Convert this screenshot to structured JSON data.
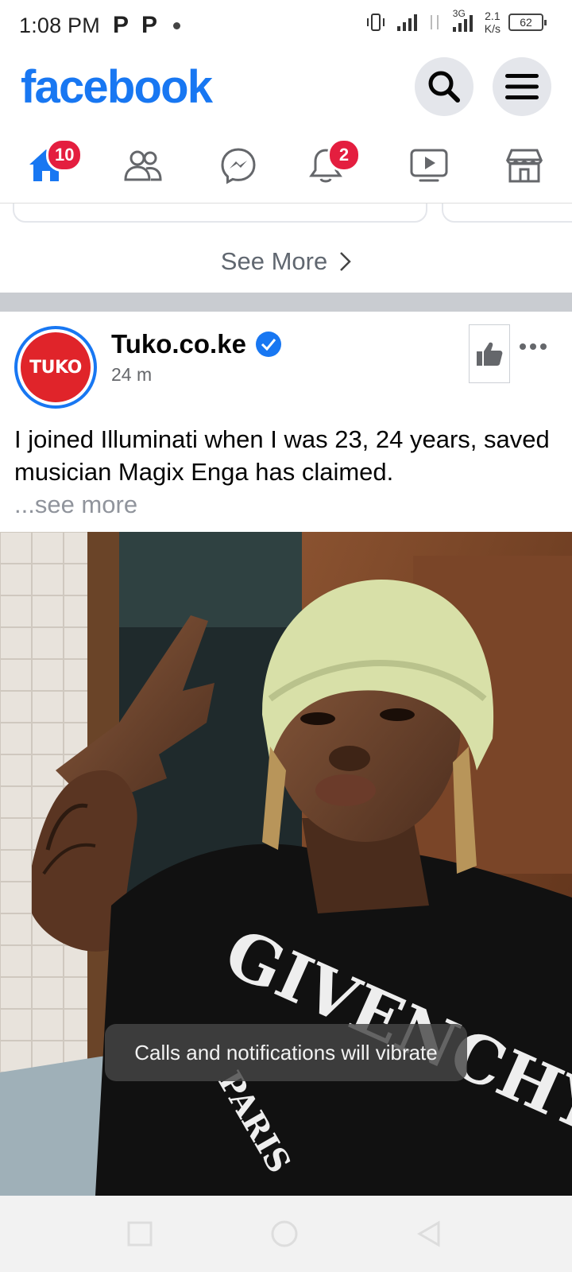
{
  "status_bar": {
    "time": "1:08 PM",
    "notification_icons": [
      "P",
      "P"
    ],
    "network_speed_value": "2.1",
    "network_speed_unit": "K/s",
    "network_type": "3G",
    "battery": "62"
  },
  "header": {
    "logo_text": "facebook",
    "search_icon": "search-icon",
    "menu_icon": "menu-icon"
  },
  "nav": {
    "items": [
      {
        "name": "home",
        "icon": "home-icon",
        "badge": "10",
        "active": true
      },
      {
        "name": "friends",
        "icon": "friends-icon"
      },
      {
        "name": "messenger",
        "icon": "messenger-icon"
      },
      {
        "name": "notifications",
        "icon": "bell-icon",
        "badge": "2"
      },
      {
        "name": "watch",
        "icon": "video-icon"
      },
      {
        "name": "marketplace",
        "icon": "store-icon"
      }
    ]
  },
  "feed": {
    "see_more_label": "See More"
  },
  "post": {
    "page_name": "Tuko.co.ke",
    "avatar_text": "TUKO",
    "time": "24 m",
    "text": "I joined Illuminati when I was 23, 24 years, saved musician Magix Enga has claimed.",
    "see_more": "...see more",
    "image_text": "GIVENCHY",
    "image_subtext": "PARIS"
  },
  "toast": {
    "message": "Calls and notifications will vibrate"
  },
  "colors": {
    "brand": "#1877f2",
    "badge": "#e41e3f",
    "divider": "#c9ccd1"
  }
}
